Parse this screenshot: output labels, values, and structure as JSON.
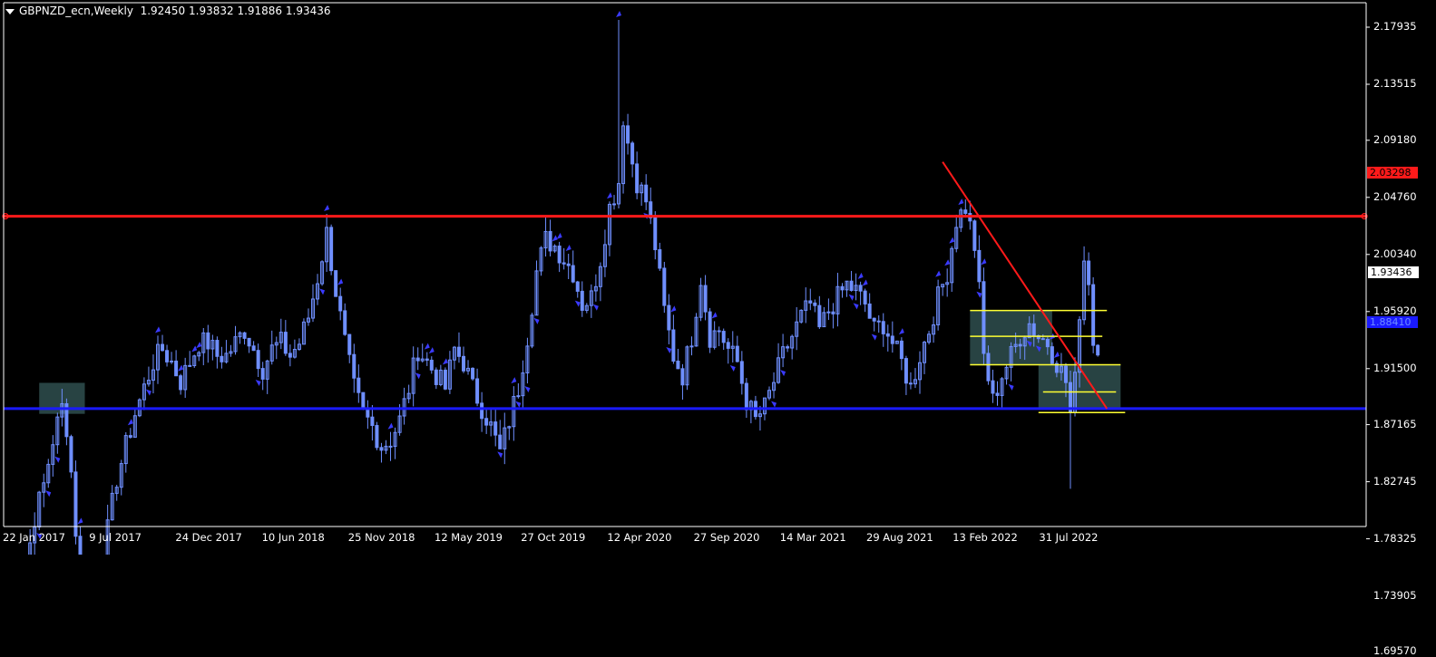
{
  "header": {
    "symbol": "GBPNZD_ecn,Weekly",
    "ohlc": "1.92450 1.93832 1.91886 1.93436"
  },
  "colors": {
    "background": "#000000",
    "candle": "#6f8fff",
    "resistance": "#ff1a1a",
    "support": "#1a1aff",
    "trendline": "#ff1a1a",
    "zones": "#2f4f4f",
    "levels": "#ffff33",
    "arrows": "#3a3aff"
  },
  "chart_data": {
    "type": "candlestick",
    "timeframe": "Weekly",
    "grid": false,
    "ylim": [
      1.6757,
      2.1963
    ],
    "y_ticks": [
      "2.17935",
      "2.13515",
      "2.09180",
      "2.04760",
      "2.00340",
      "1.95920",
      "1.91500",
      "1.87165",
      "1.82745",
      "1.78325",
      "1.73905",
      "1.69570"
    ],
    "x_ticks": [
      "22 Jan 2017",
      "9 Jul 2017",
      "24 Dec 2017",
      "10 Jun 2018",
      "25 Nov 2018",
      "12 May 2019",
      "27 Oct 2019",
      "12 Apr 2020",
      "27 Sep 2020",
      "14 Mar 2021",
      "29 Aug 2021",
      "13 Feb 2022",
      "31 Jul 2022"
    ],
    "close_path": [
      [
        0,
        1.7
      ],
      [
        2,
        1.725
      ],
      [
        4,
        1.76
      ],
      [
        6,
        1.8
      ],
      [
        8,
        1.825
      ],
      [
        10,
        1.86
      ],
      [
        12,
        1.885
      ],
      [
        13,
        1.87
      ],
      [
        14,
        1.835
      ],
      [
        15,
        1.79
      ],
      [
        16,
        1.76
      ],
      [
        18,
        1.745
      ],
      [
        20,
        1.76
      ],
      [
        22,
        1.79
      ],
      [
        24,
        1.83
      ],
      [
        26,
        1.855
      ],
      [
        28,
        1.88
      ],
      [
        30,
        1.9
      ],
      [
        32,
        1.92
      ],
      [
        34,
        1.93
      ],
      [
        36,
        1.92
      ],
      [
        38,
        1.905
      ],
      [
        40,
        1.92
      ],
      [
        42,
        1.935
      ],
      [
        44,
        1.935
      ],
      [
        46,
        1.925
      ],
      [
        48,
        1.925
      ],
      [
        50,
        1.935
      ],
      [
        52,
        1.945
      ],
      [
        54,
        1.93
      ],
      [
        56,
        1.915
      ],
      [
        58,
        1.93
      ],
      [
        60,
        1.935
      ],
      [
        62,
        1.925
      ],
      [
        64,
        1.935
      ],
      [
        66,
        1.955
      ],
      [
        68,
        1.985
      ],
      [
        70,
        2.02
      ],
      [
        72,
        1.975
      ],
      [
        74,
        1.935
      ],
      [
        76,
        1.9
      ],
      [
        78,
        1.88
      ],
      [
        80,
        1.87
      ],
      [
        82,
        1.855
      ],
      [
        84,
        1.86
      ],
      [
        86,
        1.875
      ],
      [
        88,
        1.9
      ],
      [
        90,
        1.93
      ],
      [
        92,
        1.92
      ],
      [
        94,
        1.91
      ],
      [
        96,
        1.9
      ],
      [
        98,
        1.93
      ],
      [
        100,
        1.92
      ],
      [
        102,
        1.9
      ],
      [
        104,
        1.885
      ],
      [
        106,
        1.87
      ],
      [
        108,
        1.85
      ],
      [
        110,
        1.875
      ],
      [
        112,
        1.9
      ],
      [
        114,
        1.94
      ],
      [
        116,
        1.99
      ],
      [
        118,
        2.015
      ],
      [
        120,
        2.01
      ],
      [
        122,
        2.0
      ],
      [
        124,
        1.99
      ],
      [
        126,
        1.965
      ],
      [
        128,
        1.97
      ],
      [
        130,
        2.0
      ],
      [
        132,
        2.04
      ],
      [
        134,
        2.06
      ],
      [
        135,
        2.11
      ],
      [
        136,
        2.09
      ],
      [
        138,
        2.06
      ],
      [
        140,
        2.045
      ],
      [
        142,
        2.01
      ],
      [
        144,
        1.96
      ],
      [
        146,
        1.925
      ],
      [
        148,
        1.91
      ],
      [
        150,
        1.94
      ],
      [
        152,
        1.985
      ],
      [
        154,
        1.94
      ],
      [
        156,
        1.945
      ],
      [
        158,
        1.93
      ],
      [
        160,
        1.92
      ],
      [
        162,
        1.89
      ],
      [
        164,
        1.875
      ],
      [
        166,
        1.885
      ],
      [
        168,
        1.905
      ],
      [
        170,
        1.925
      ],
      [
        172,
        1.94
      ],
      [
        174,
        1.955
      ],
      [
        176,
        1.965
      ],
      [
        178,
        1.945
      ],
      [
        180,
        1.96
      ],
      [
        182,
        1.97
      ],
      [
        184,
        1.98
      ],
      [
        186,
        1.975
      ],
      [
        188,
        1.965
      ],
      [
        190,
        1.945
      ],
      [
        192,
        1.95
      ],
      [
        194,
        1.935
      ],
      [
        196,
        1.92
      ],
      [
        198,
        1.9
      ],
      [
        200,
        1.925
      ],
      [
        202,
        1.945
      ],
      [
        204,
        1.97
      ],
      [
        206,
        1.99
      ],
      [
        208,
        2.03
      ],
      [
        210,
        2.04
      ],
      [
        212,
        2.01
      ],
      [
        213,
        1.975
      ],
      [
        214,
        1.925
      ],
      [
        216,
        1.89
      ],
      [
        218,
        1.91
      ],
      [
        220,
        1.925
      ],
      [
        222,
        1.94
      ],
      [
        224,
        1.95
      ],
      [
        226,
        1.94
      ],
      [
        228,
        1.935
      ],
      [
        230,
        1.92
      ],
      [
        232,
        1.905
      ],
      [
        233,
        1.88
      ],
      [
        234,
        1.905
      ],
      [
        235,
        1.96
      ],
      [
        236,
        2.0
      ],
      [
        237,
        1.985
      ],
      [
        238,
        1.935
      ],
      [
        239,
        1.934
      ]
    ],
    "horizontal_levels": [
      {
        "value": 2.03298,
        "label": "2.03298",
        "color": "#ff1a1a"
      },
      {
        "value": 1.8841,
        "label": "1.88410",
        "color": "#1a1aff"
      }
    ],
    "current_price": "1.93436",
    "trendline": {
      "from": [
        205,
        2.075
      ],
      "to": [
        241,
        1.884
      ]
    },
    "zones": [
      {
        "x0": 7,
        "x1": 17,
        "y0": 1.904,
        "y1": 1.88
      },
      {
        "x0": 211,
        "x1": 229,
        "y0": 1.96,
        "y1": 1.918
      },
      {
        "x0": 226,
        "x1": 244,
        "y0": 1.918,
        "y1": 1.883
      }
    ],
    "level_segments": [
      {
        "x0": 211,
        "x1": 241,
        "y": 1.96
      },
      {
        "x0": 211,
        "x1": 240,
        "y": 1.94
      },
      {
        "x0": 211,
        "x1": 244,
        "y": 1.918
      },
      {
        "x0": 227,
        "x1": 243,
        "y": 1.897
      },
      {
        "x0": 226,
        "x1": 245,
        "y": 1.881
      }
    ]
  }
}
